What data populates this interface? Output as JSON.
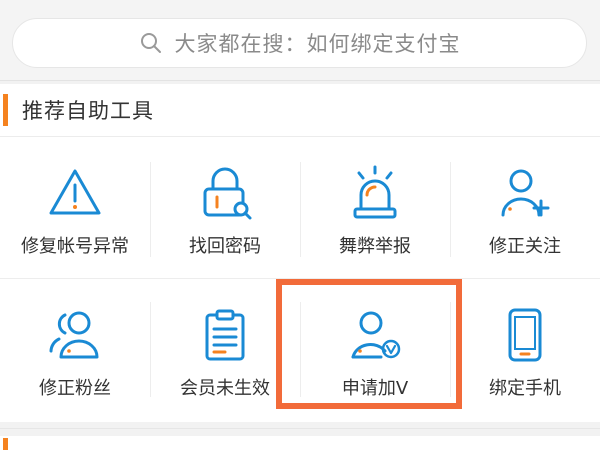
{
  "search": {
    "text": "大家都在搜：如何绑定支付宝",
    "icon": "search-icon"
  },
  "section": {
    "title": "推荐自助工具",
    "accent_color": "#f5821f"
  },
  "tools": [
    {
      "label": "修复帐号异常",
      "icon": "warning-triangle-icon"
    },
    {
      "label": "找回密码",
      "icon": "lock-search-icon"
    },
    {
      "label": "舞弊举报",
      "icon": "alarm-light-icon"
    },
    {
      "label": "修正关注",
      "icon": "user-add-icon"
    },
    {
      "label": "修正粉丝",
      "icon": "users-group-icon"
    },
    {
      "label": "会员未生效",
      "icon": "clipboard-icon"
    },
    {
      "label": "申请加V",
      "icon": "user-verified-icon"
    },
    {
      "label": "绑定手机",
      "icon": "mobile-phone-icon"
    }
  ],
  "colors": {
    "icon_blue": "#1a8ad4",
    "icon_accent_orange": "#f5821f",
    "highlight": "#f26b3a"
  }
}
